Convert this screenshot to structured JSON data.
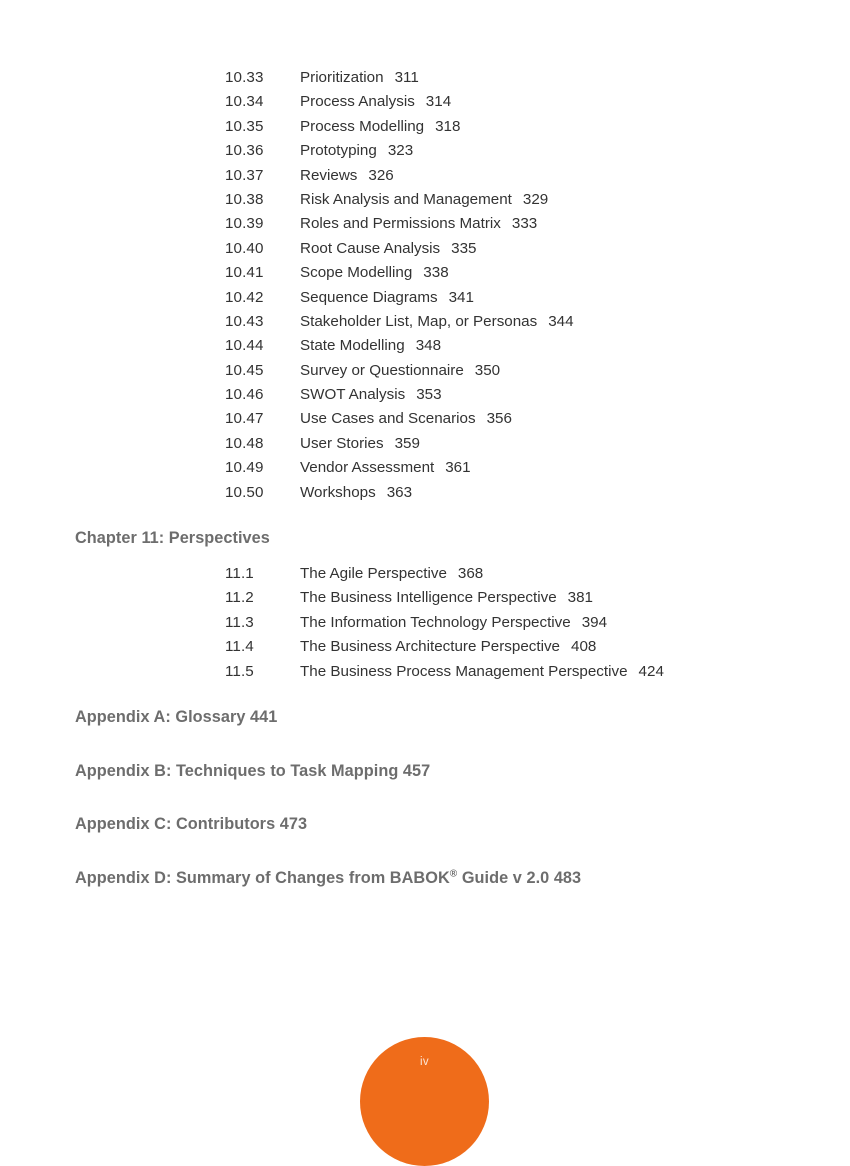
{
  "document": {
    "folio": "iv",
    "folio_color": "#ef6c1a",
    "heading_color": "#6d6d6d",
    "body_color": "#333333"
  },
  "toc": {
    "chapter10_entries": [
      {
        "number": "10.33",
        "title": "Prioritization",
        "page": "311"
      },
      {
        "number": "10.34",
        "title": "Process Analysis",
        "page": "314"
      },
      {
        "number": "10.35",
        "title": "Process Modelling",
        "page": "318"
      },
      {
        "number": "10.36",
        "title": "Prototyping",
        "page": "323"
      },
      {
        "number": "10.37",
        "title": "Reviews",
        "page": "326"
      },
      {
        "number": "10.38",
        "title": "Risk Analysis and Management",
        "page": "329"
      },
      {
        "number": "10.39",
        "title": "Roles and Permissions Matrix",
        "page": "333"
      },
      {
        "number": "10.40",
        "title": "Root Cause Analysis",
        "page": "335"
      },
      {
        "number": "10.41",
        "title": "Scope Modelling",
        "page": "338"
      },
      {
        "number": "10.42",
        "title": "Sequence Diagrams",
        "page": "341"
      },
      {
        "number": "10.43",
        "title": "Stakeholder List, Map, or Personas",
        "page": "344"
      },
      {
        "number": "10.44",
        "title": "State Modelling",
        "page": "348"
      },
      {
        "number": "10.45",
        "title": "Survey or Questionnaire",
        "page": "350"
      },
      {
        "number": "10.46",
        "title": "SWOT Analysis",
        "page": "353"
      },
      {
        "number": "10.47",
        "title": "Use Cases and Scenarios",
        "page": "356"
      },
      {
        "number": "10.48",
        "title": "User Stories",
        "page": "359"
      },
      {
        "number": "10.49",
        "title": "Vendor Assessment",
        "page": "361"
      },
      {
        "number": "10.50",
        "title": "Workshops",
        "page": "363"
      }
    ],
    "chapter11_heading": "Chapter 11: Perspectives",
    "chapter11_entries": [
      {
        "number": "11.1",
        "title": "The Agile Perspective",
        "page": "368"
      },
      {
        "number": "11.2",
        "title": "The Business Intelligence Perspective",
        "page": "381"
      },
      {
        "number": "11.3",
        "title": "The Information Technology Perspective",
        "page": "394"
      },
      {
        "number": "11.4",
        "title": "The Business Architecture Perspective",
        "page": "408"
      },
      {
        "number": "11.5",
        "title": "The Business Process Management Perspective",
        "page": "424"
      }
    ],
    "appendix_a": "Appendix A: Glossary 441",
    "appendix_b": "Appendix B: Techniques to Task Mapping 457",
    "appendix_c": "Appendix C: Contributors 473",
    "appendix_d_prefix": "Appendix D: Summary of Changes from BABOK",
    "appendix_d_mark": "®",
    "appendix_d_suffix": " Guide v 2.0 483"
  }
}
